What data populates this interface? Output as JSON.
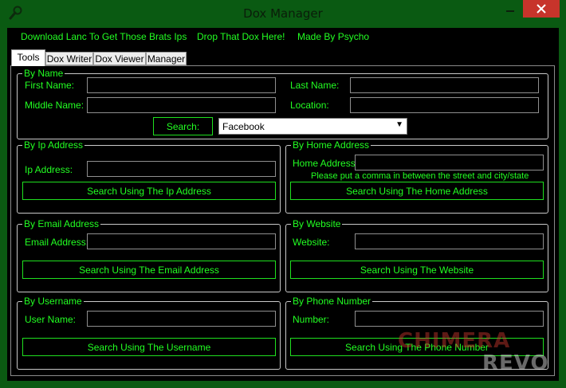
{
  "window": {
    "title": "Dox Manager"
  },
  "menu": [
    "Download Lanc To Get Those Brats Ips",
    "Drop That Dox Here!",
    "Made By Psycho"
  ],
  "tabs": [
    "Tools",
    "Dox Writer",
    "Dox Viewer",
    "Manager"
  ],
  "by_name": {
    "title": "By Name",
    "first_name": "First Name:",
    "last_name": "Last Name:",
    "middle_name": "Middle Name:",
    "location": "Location:",
    "search_button": "Search:",
    "site_select": "Facebook"
  },
  "by_ip": {
    "title": "By Ip Address",
    "label": "Ip Address:",
    "button": "Search Using The Ip Address"
  },
  "by_home": {
    "title": "By Home Address",
    "label": "Home Address:",
    "note": "Please put a comma in between the street and city/state",
    "button": "Search Using The Home Address"
  },
  "by_email": {
    "title": "By Email Address",
    "label": "Email Address:",
    "button": "Search Using The Email Address"
  },
  "by_website": {
    "title": "By Website",
    "label": "Website:",
    "button": "Search Using The Website"
  },
  "by_username": {
    "title": "By Username",
    "label": "User Name:",
    "button": "Search Using The Username"
  },
  "by_phone": {
    "title": "By Phone Number",
    "label": "Number:",
    "button": "Search Using The Phone Number"
  },
  "watermark": {
    "line1": "CHIMERA",
    "line2": "REVO"
  },
  "colors": {
    "accent": "#22ff22",
    "background": "#000000",
    "frame": "#0b5a12",
    "close": "#c7342b"
  }
}
